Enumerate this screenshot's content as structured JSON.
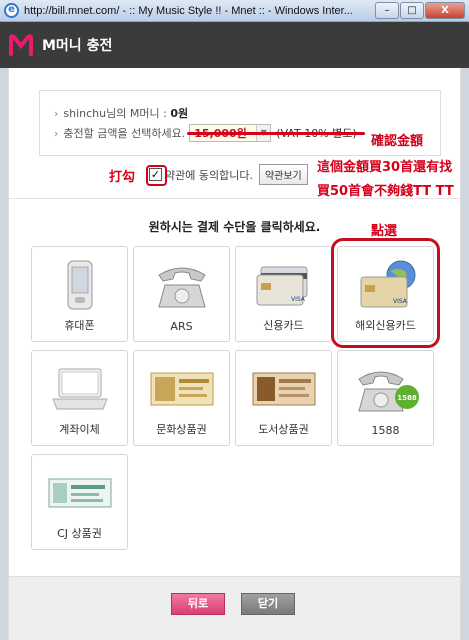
{
  "window": {
    "title": "http://bill.mnet.com/ - :: My Music Style !! - Mnet :: - Windows Inter...",
    "minimize": "–",
    "maximize": "□",
    "close": "X"
  },
  "header": {
    "title": "M머니 충전"
  },
  "info": {
    "balance_user": "shinchu님의 M머니 :",
    "balance_value": "0원",
    "amount_label": "충전할 금액을 선택하세요.",
    "amount_value": "15,000원",
    "vat_note": "(VAT 10% 별도)"
  },
  "agree": {
    "text": "약관에 동의합니다.",
    "checked": true,
    "terms_button": "약관보기"
  },
  "annotations": {
    "confirm_amount": "確認金額",
    "check_mark": "打勾",
    "note_line1": "這個金額買30首還有找",
    "note_line2": "買50首會不夠錢TT TT",
    "click_here": "點選"
  },
  "instruction": "원하시는 결제 수단을 클릭하세요.",
  "payment_methods": [
    {
      "label": "휴대폰",
      "icon": "mobile-phone-icon"
    },
    {
      "label": "ARS",
      "icon": "telephone-icon"
    },
    {
      "label": "신용카드",
      "icon": "credit-card-icon"
    },
    {
      "label": "해외신용카드",
      "icon": "overseas-credit-card-icon",
      "selected": true
    },
    {
      "label": "계좌이체",
      "icon": "laptop-icon"
    },
    {
      "label": "문화상품권",
      "icon": "culture-gift-certificate-icon"
    },
    {
      "label": "도서상품권",
      "icon": "book-gift-certificate-icon"
    },
    {
      "label": "1588",
      "icon": "telephone-1588-icon",
      "badge": "1588"
    },
    {
      "label": "CJ 상품권",
      "icon": "cj-gift-certificate-icon"
    }
  ],
  "footer": {
    "back": "뒤로",
    "close": "닫기"
  },
  "colors": {
    "accent_red": "#d4001a",
    "header_bg": "#3b3b3b",
    "back_button": "#d93f72"
  }
}
